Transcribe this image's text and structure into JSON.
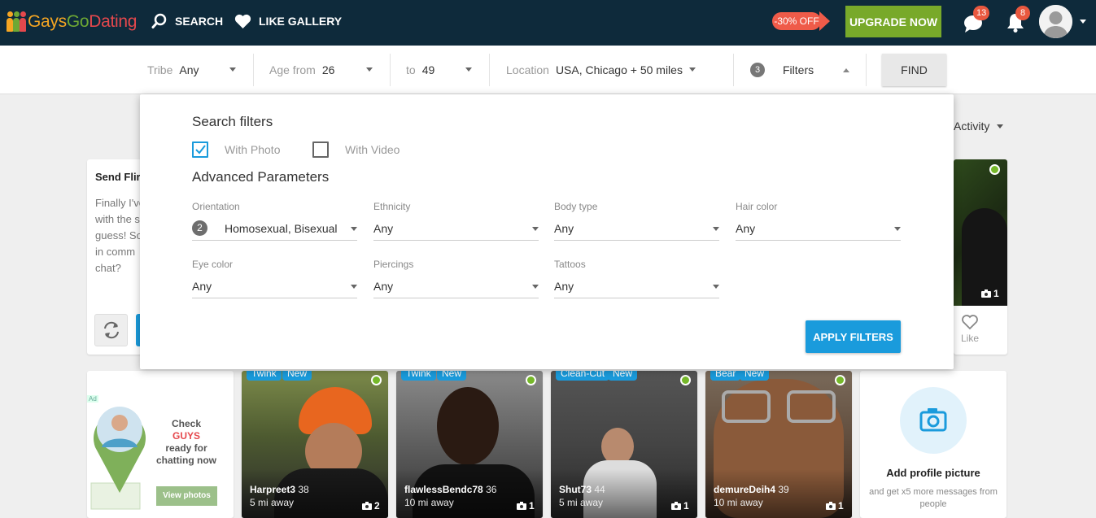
{
  "brand": {
    "part1": "Gays",
    "part2": "Go",
    "part3": "Dating"
  },
  "nav": {
    "search": "SEARCH",
    "like_gallery": "LIKE GALLERY"
  },
  "promo": {
    "discount": "-30% OFF",
    "upgrade": "UPGRADE NOW"
  },
  "badges": {
    "messages": "13",
    "notifications": "8"
  },
  "searchbar": {
    "tribe": {
      "label": "Tribe",
      "value": "Any"
    },
    "age_from": {
      "label": "Age from",
      "value": "26"
    },
    "age_to": {
      "label": "to",
      "value": "49"
    },
    "location": {
      "label": "Location",
      "value": "USA, Chicago + 50 miles"
    },
    "filters": {
      "count": "3",
      "label": "Filters"
    },
    "find": "FIND"
  },
  "sort": {
    "label": "Activity"
  },
  "flirt": {
    "title": "Send Flirt",
    "text_lines": [
      "Finally I've",
      "with the s",
      "guess! So",
      "in comm",
      "chat?"
    ]
  },
  "profile_top": {
    "photos": "1",
    "like": "Like"
  },
  "filters_panel": {
    "heading": "Search filters",
    "with_photo": {
      "label": "With Photo",
      "checked": true
    },
    "with_video": {
      "label": "With Video",
      "checked": false
    },
    "advanced": "Advanced Parameters",
    "params": [
      {
        "label": "Orientation",
        "value": "Homosexual, Bisexual",
        "count": "2"
      },
      {
        "label": "Ethnicity",
        "value": "Any"
      },
      {
        "label": "Body type",
        "value": "Any"
      },
      {
        "label": "Hair color",
        "value": "Any"
      },
      {
        "label": "Eye color",
        "value": "Any"
      },
      {
        "label": "Piercings",
        "value": "Any"
      },
      {
        "label": "Tattoos",
        "value": "Any"
      }
    ],
    "apply": "APPLY FILTERS"
  },
  "ad": {
    "label": "Ad",
    "line1": "Check",
    "line2": "GUYS",
    "line3": "ready for chatting now",
    "button": "View photos"
  },
  "users": [
    {
      "tags": [
        "Twink",
        "New"
      ],
      "name": "Harpreet3",
      "age": "38",
      "distance": "5 mi away",
      "photos": "2"
    },
    {
      "tags": [
        "Twink",
        "New"
      ],
      "name": "flawlessBendc78",
      "age": "36",
      "distance": "10 mi away",
      "photos": "1"
    },
    {
      "tags": [
        "Clean-Cut",
        "New"
      ],
      "name": "Shut73",
      "age": "44",
      "distance": "5 mi away",
      "photos": "1"
    },
    {
      "tags": [
        "Bear",
        "New"
      ],
      "name": "demureDeih4",
      "age": "39",
      "distance": "10 mi away",
      "photos": "1"
    }
  ],
  "add_picture": {
    "title": "Add profile picture",
    "subtitle": "and get x5 more messages from people"
  },
  "colors": {
    "nav_bg": "#0e2a3b",
    "accent_blue": "#1a9bdc",
    "upgrade_green": "#78a92a",
    "discount_red": "#ef5b49",
    "online_green": "#76b82a"
  }
}
